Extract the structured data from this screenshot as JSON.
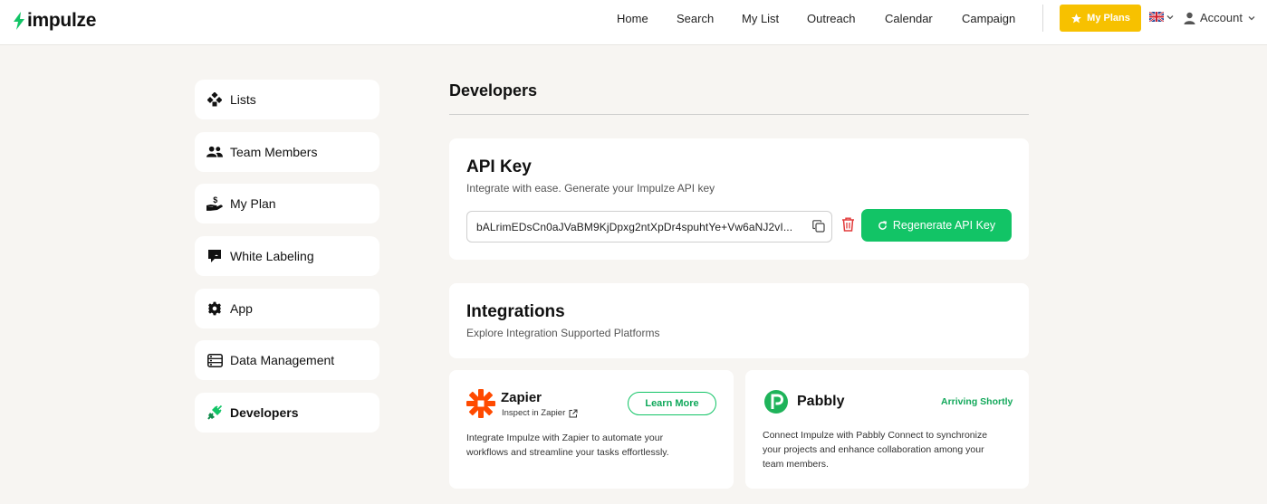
{
  "brand": {
    "name": "impulze",
    "accent": "#12c466",
    "bolt_color": "#12c466"
  },
  "nav": {
    "items": [
      "Home",
      "Search",
      "My List",
      "Outreach",
      "Calendar",
      "Campaign"
    ],
    "my_plans": "My Plans",
    "account": "Account",
    "language_icon": "uk-flag-icon"
  },
  "sidebar": {
    "items": [
      {
        "label": "Lists",
        "icon": "lists-icon"
      },
      {
        "label": "Team Members",
        "icon": "users-icon"
      },
      {
        "label": "My Plan",
        "icon": "hand-dollar-icon"
      },
      {
        "label": "White Labeling",
        "icon": "tag-icon"
      },
      {
        "label": "App",
        "icon": "gear-icon"
      },
      {
        "label": "Data Management",
        "icon": "database-icon"
      },
      {
        "label": "Developers",
        "icon": "plug-icon"
      }
    ],
    "active": "Developers"
  },
  "page": {
    "title": "Developers"
  },
  "api_key": {
    "title": "API Key",
    "subtitle": "Integrate with ease. Generate your Impulze API key",
    "value": "bALrimEDsCn0aJVaBM9KjDpxg2ntXpDr4spuhtYe+Vw6aNJ2vI...",
    "regenerate_label": "Regenerate API Key"
  },
  "integrations": {
    "title": "Integrations",
    "subtitle": "Explore Integration Supported Platforms",
    "zapier": {
      "name": "Zapier",
      "inspect": "Inspect in Zapier",
      "learn_more": "Learn More",
      "desc_line1": "Integrate Impulze with Zapier to automate your",
      "desc_line2": "workflows and streamline your tasks effortlessly."
    },
    "pabbly": {
      "name": "Pabbly",
      "status": "Arriving Shortly",
      "desc_line1": "Connect Impulze with Pabbly Connect to synchronize",
      "desc_line2": "your projects and enhance collaboration among your",
      "desc_line3": "team members."
    }
  }
}
